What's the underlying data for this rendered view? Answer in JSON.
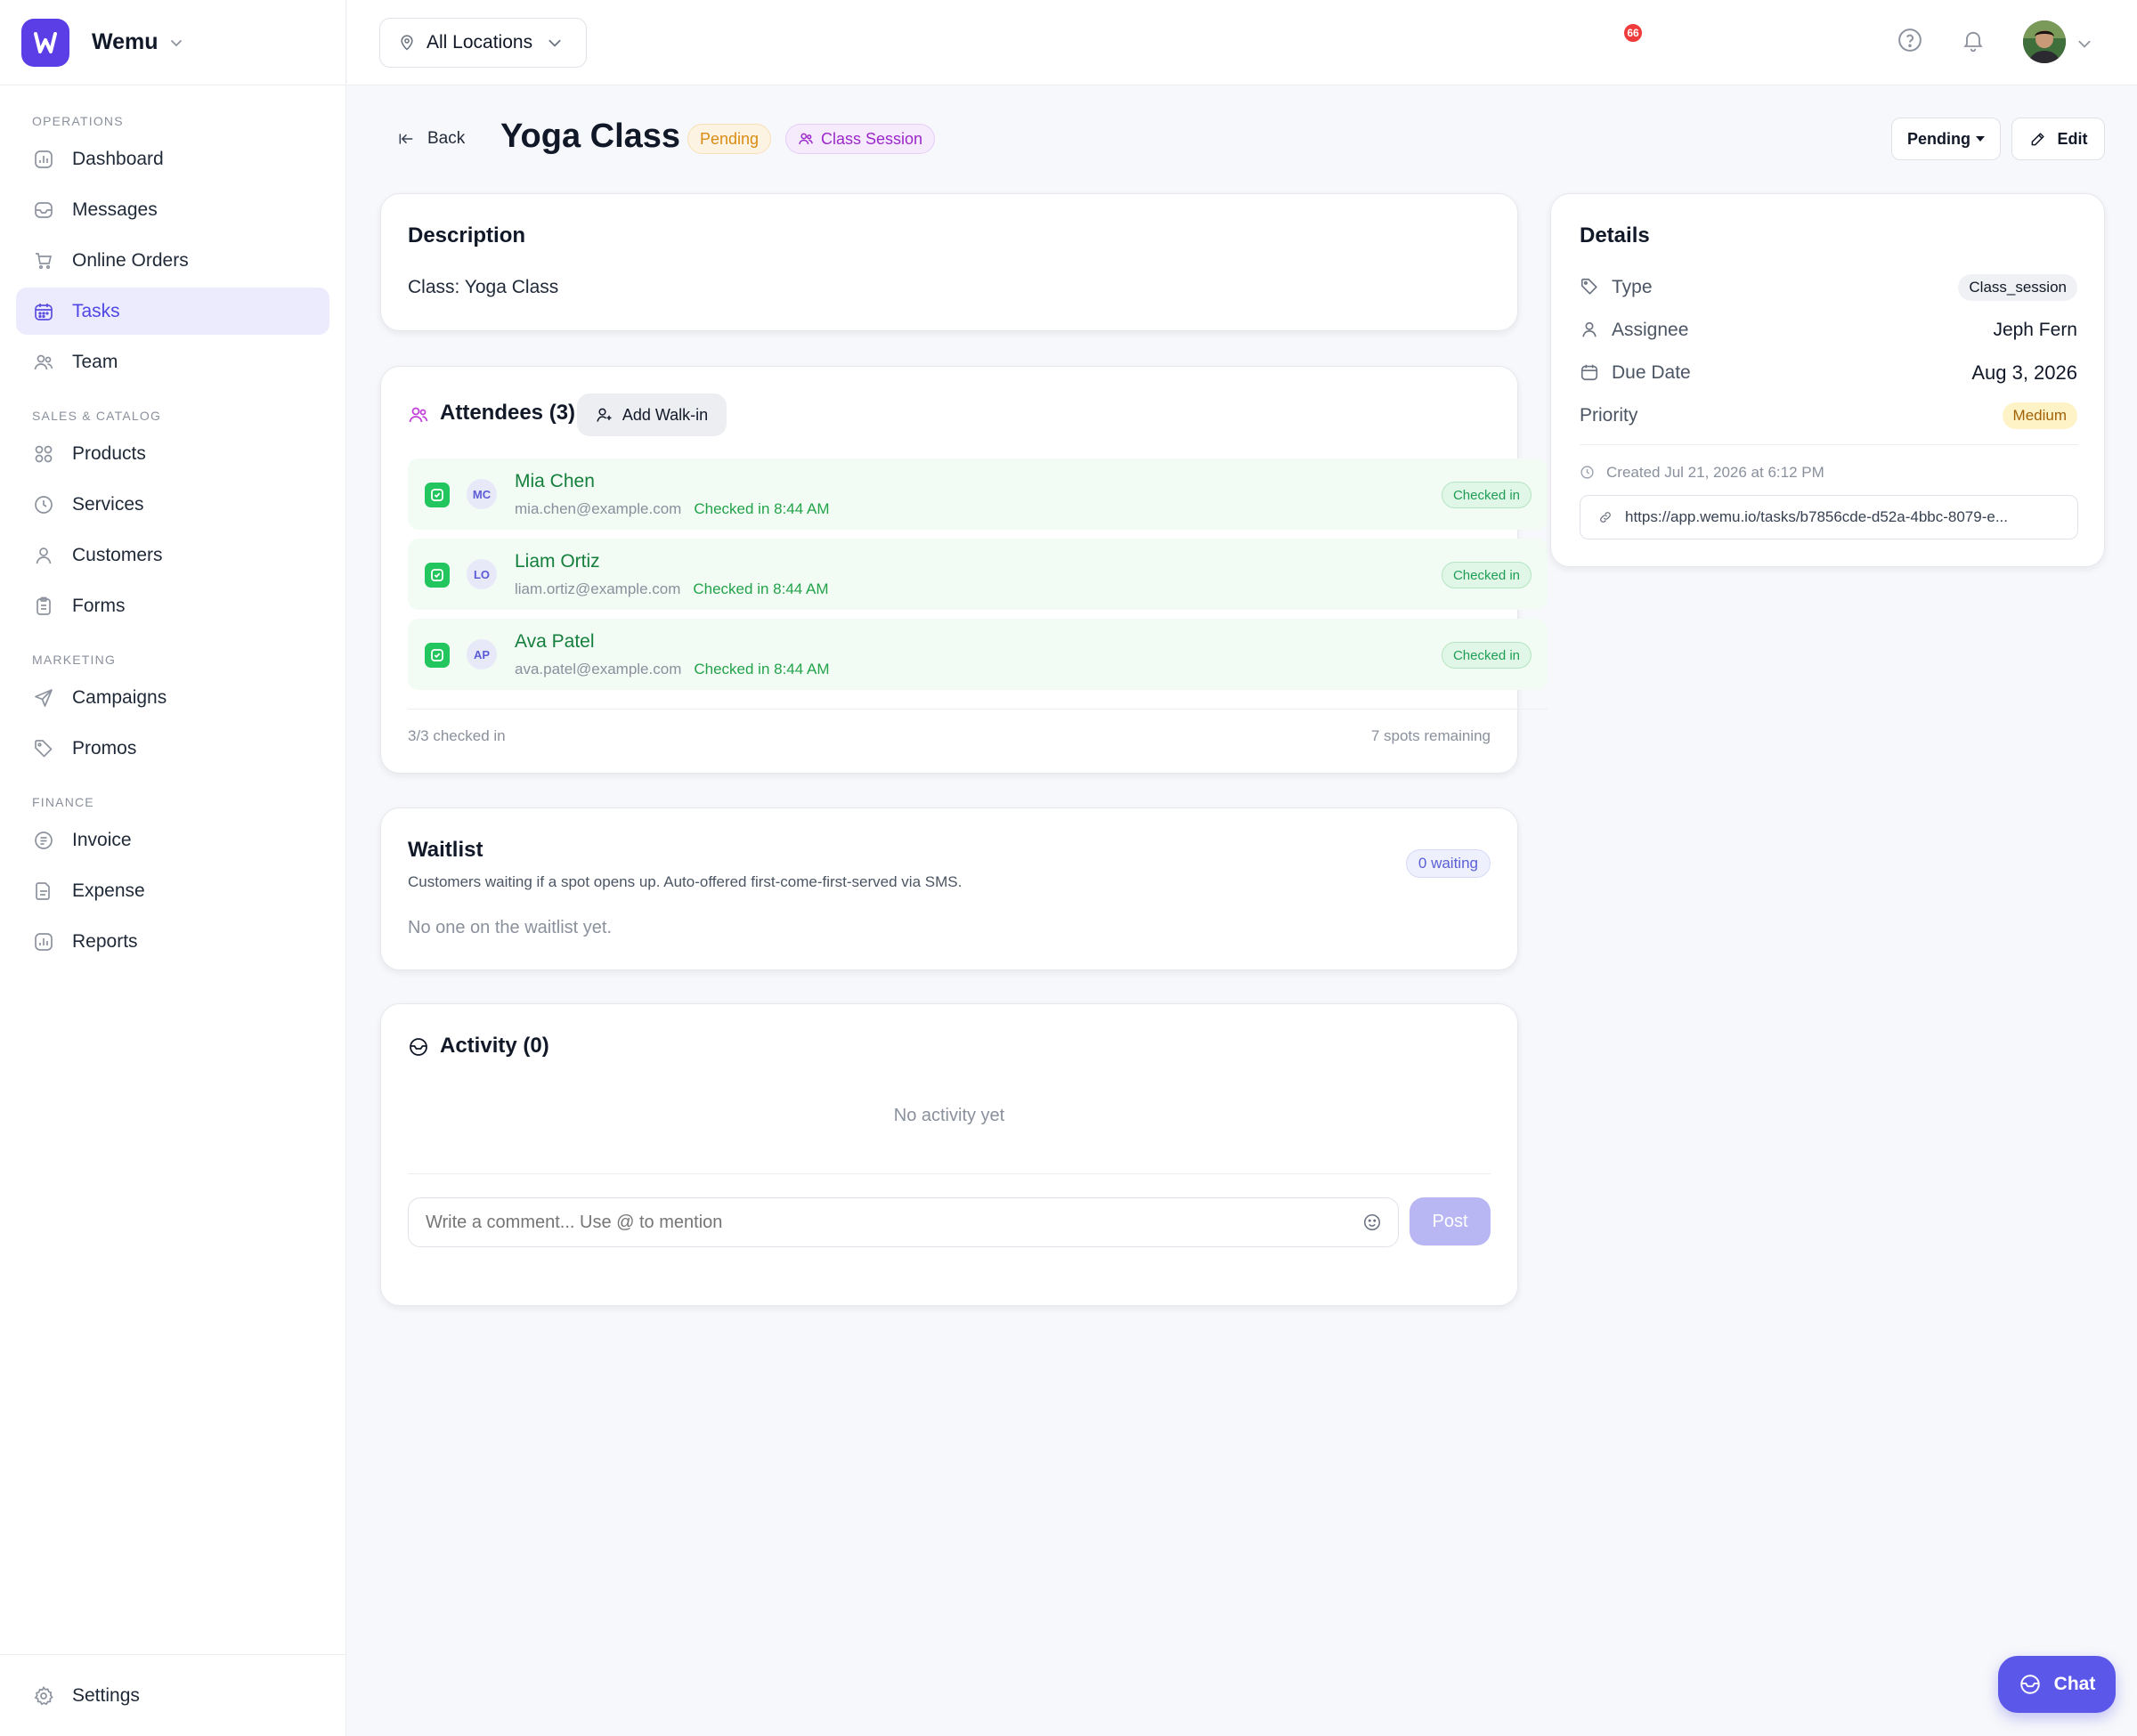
{
  "brand": {
    "name": "Wemu"
  },
  "sidebar": {
    "sections": [
      {
        "label": "OPERATIONS",
        "items": [
          {
            "label": "Dashboard",
            "icon": "chart-icon"
          },
          {
            "label": "Messages",
            "icon": "inbox-icon"
          },
          {
            "label": "Online Orders",
            "icon": "cart-icon"
          },
          {
            "label": "Tasks",
            "icon": "calendar-icon",
            "active": true
          },
          {
            "label": "Team",
            "icon": "users-icon"
          }
        ]
      },
      {
        "label": "SALES & CATALOG",
        "items": [
          {
            "label": "Products",
            "icon": "grid-icon"
          },
          {
            "label": "Services",
            "icon": "clock-icon"
          },
          {
            "label": "Customers",
            "icon": "user-icon"
          },
          {
            "label": "Forms",
            "icon": "clipboard-icon"
          }
        ]
      },
      {
        "label": "MARKETING",
        "items": [
          {
            "label": "Campaigns",
            "icon": "send-icon"
          },
          {
            "label": "Promos",
            "icon": "tag-icon"
          }
        ]
      },
      {
        "label": "FINANCE",
        "items": [
          {
            "label": "Invoice",
            "icon": "invoice-icon"
          },
          {
            "label": "Expense",
            "icon": "expense-icon"
          },
          {
            "label": "Reports",
            "icon": "chart-icon"
          }
        ]
      }
    ],
    "settings_label": "Settings"
  },
  "topbar": {
    "location": "All Locations",
    "notification_count": "66"
  },
  "header": {
    "back_label": "Back",
    "title": "Yoga Class",
    "status_pill": "Pending",
    "type_pill": "Class Session",
    "status_button": "Pending",
    "edit_button": "Edit"
  },
  "description": {
    "title": "Description",
    "text": "Class: Yoga Class"
  },
  "attendees": {
    "title": "Attendees (3)",
    "add_walkin_label": "Add Walk-in",
    "list": [
      {
        "initials": "MC",
        "name": "Mia Chen",
        "email": "mia.chen@example.com",
        "checkin": "Checked in 8:44 AM",
        "badge": "Checked in"
      },
      {
        "initials": "LO",
        "name": "Liam Ortiz",
        "email": "liam.ortiz@example.com",
        "checkin": "Checked in 8:44 AM",
        "badge": "Checked in"
      },
      {
        "initials": "AP",
        "name": "Ava Patel",
        "email": "ava.patel@example.com",
        "checkin": "Checked in 8:44 AM",
        "badge": "Checked in"
      }
    ],
    "checked_summary": "3/3 checked in",
    "spots_remaining": "7 spots remaining"
  },
  "waitlist": {
    "title": "Waitlist",
    "subtitle": "Customers waiting if a spot opens up. Auto-offered first-come-first-served via SMS.",
    "badge": "0 waiting",
    "empty_text": "No one on the waitlist yet."
  },
  "activity": {
    "title": "Activity (0)",
    "empty_text": "No activity yet",
    "comment_placeholder": "Write a comment... Use @ to mention",
    "post_label": "Post"
  },
  "details": {
    "title": "Details",
    "type_label": "Type",
    "type_value": "Class_session",
    "assignee_label": "Assignee",
    "assignee_value": "Jeph Fern",
    "due_label": "Due Date",
    "due_value": "Aug 3, 2026",
    "priority_label": "Priority",
    "priority_value": "Medium",
    "created": "Created Jul 21, 2026 at 6:12 PM",
    "url": "https://app.wemu.io/tasks/b7856cde-d52a-4bbc-8079-e..."
  },
  "chat": {
    "label": "Chat"
  },
  "colors": {
    "accent": "#5b3ee6",
    "success": "#22c55e",
    "warning": "#d98c12"
  }
}
